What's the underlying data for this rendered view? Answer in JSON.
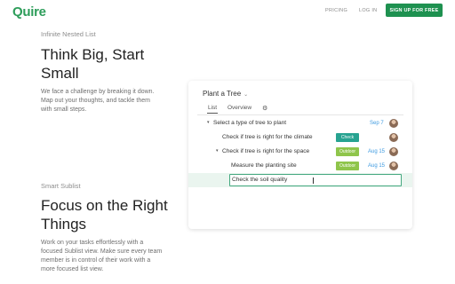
{
  "header": {
    "logo": "Quire",
    "nav": [
      "PRICING",
      "LOG IN"
    ],
    "cta": "SIGN UP FOR FREE"
  },
  "section1": {
    "eyebrow": "Infinite Nested List",
    "title": "Think Big, Start Small",
    "body": "We face a challenge by breaking it down. Map out your thoughts, and tackle them with small steps."
  },
  "section2": {
    "eyebrow": "Smart Sublist",
    "title": "Focus on the Right Things",
    "body": "Work on your tasks effortlessly with a focused Sublist view. Make sure every team member is in control of their work with a more focused list view."
  },
  "app": {
    "project": "Plant a Tree",
    "tabs": [
      "List",
      "Overview"
    ],
    "tasks": [
      {
        "text": "Select a type of tree to plant",
        "date": "Sep 7",
        "tag": "",
        "expanded": true
      },
      {
        "text": "Check if tree is right for the climate",
        "date": "",
        "tag": "Check"
      },
      {
        "text": "Check if tree is right for the space",
        "date": "Aug 15",
        "tag": "Outdoor",
        "expanded": true
      },
      {
        "text": "Measure the planting site",
        "date": "Aug 15",
        "tag": "Outdoor"
      },
      {
        "text": "Check the soil quality",
        "date": "",
        "tag": "",
        "editing": true
      }
    ],
    "tag_colors": {
      "Check": "#27a391",
      "Outdoor": "#8fc54b"
    }
  }
}
